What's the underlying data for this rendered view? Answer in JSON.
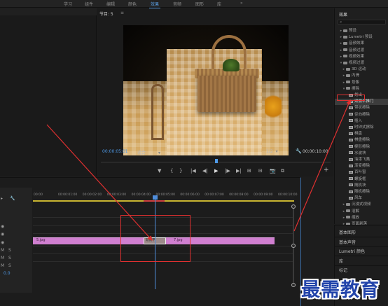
{
  "workspace_tabs": [
    "学习",
    "组件",
    "编辑",
    "颜色",
    "效果",
    "音频",
    "图形",
    "库",
    "»"
  ],
  "active_tab": "效果",
  "program": {
    "title": "节目: 5",
    "menu_label": "≡",
    "timecode_current": "00:00:05:01",
    "fit": "适合",
    "resolution": "1/2",
    "timecode_duration": "00:00:10:00"
  },
  "controls": [
    "▼",
    "{",
    "}",
    "|◀",
    "◀|",
    "▶",
    "|▶",
    "▶|",
    "⊞",
    "⊟",
    "📷",
    "⧉",
    "+"
  ],
  "effects_panel": {
    "title": "效果",
    "search_icon": "⌕",
    "rows": [
      {
        "label": "预设",
        "kind": "folder"
      },
      {
        "label": "Lumetri 预设",
        "kind": "folder"
      },
      {
        "label": "音频效果",
        "kind": "folder"
      },
      {
        "label": "音频过渡",
        "kind": "folder"
      },
      {
        "label": "视频效果",
        "kind": "folder"
      },
      {
        "label": "视频过渡",
        "kind": "folder"
      },
      {
        "label": "3D 运动",
        "kind": "folder"
      },
      {
        "label": "内滑",
        "kind": "folder"
      },
      {
        "label": "划像",
        "kind": "folder"
      },
      {
        "label": "擦除",
        "kind": "folder"
      },
      {
        "label": "划出",
        "kind": "item"
      },
      {
        "label": "双侧平推门",
        "kind": "item",
        "selected": true
      },
      {
        "label": "带状擦除",
        "kind": "item"
      },
      {
        "label": "径向擦除",
        "kind": "item"
      },
      {
        "label": "插入",
        "kind": "item"
      },
      {
        "label": "时钟式擦除",
        "kind": "item"
      },
      {
        "label": "棋盘",
        "kind": "item"
      },
      {
        "label": "棋盘擦除",
        "kind": "item"
      },
      {
        "label": "楔形擦除",
        "kind": "item"
      },
      {
        "label": "水波块",
        "kind": "item"
      },
      {
        "label": "油漆飞溅",
        "kind": "item"
      },
      {
        "label": "渐变擦除",
        "kind": "item"
      },
      {
        "label": "百叶窗",
        "kind": "item"
      },
      {
        "label": "螺旋框",
        "kind": "item"
      },
      {
        "label": "随机块",
        "kind": "item"
      },
      {
        "label": "随机擦除",
        "kind": "item"
      },
      {
        "label": "风车",
        "kind": "item"
      },
      {
        "label": "沉浸式视频",
        "kind": "folder"
      },
      {
        "label": "溶解",
        "kind": "folder"
      },
      {
        "label": "缩放",
        "kind": "folder"
      },
      {
        "label": "页面剥落",
        "kind": "folder"
      }
    ]
  },
  "right_panels": [
    "基本图形",
    "基本声音",
    "Lumetri 颜色",
    "库",
    "标记"
  ],
  "timeline": {
    "ticks": [
      "00:00",
      "00:00:01:00",
      "00:00:02:00",
      "00:00:03:00",
      "00:00:04:00",
      "00:00:05:00",
      "00:00:06:00",
      "00:00:07:00",
      "00:00:08:00",
      "00:00:09:00",
      "00:00:10:00"
    ],
    "clip_a": "5.jpg",
    "clip_b": "7.jpg",
    "transition_label": "双侧平",
    "track_value": "0.0"
  },
  "watermark": "最需教育"
}
